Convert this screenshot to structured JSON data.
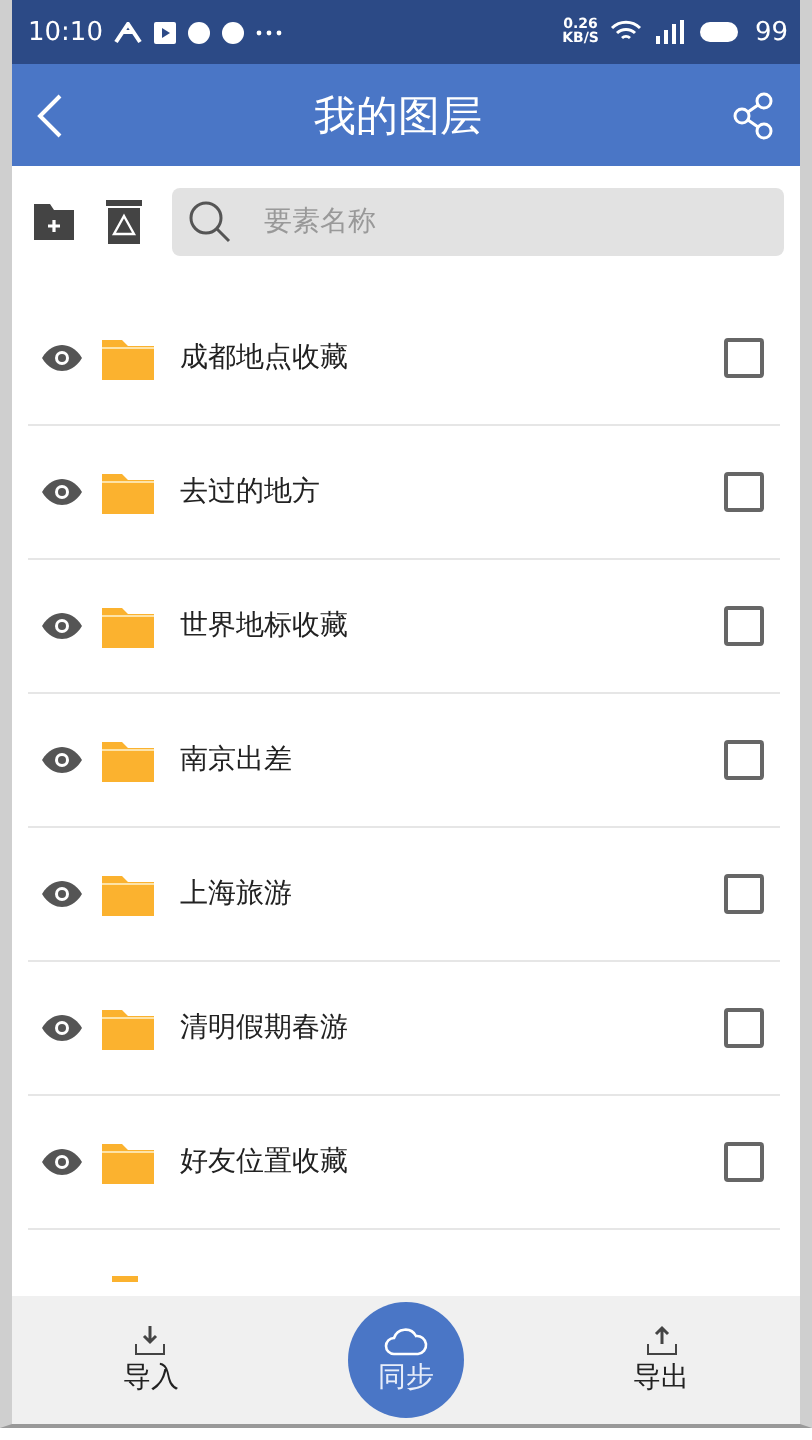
{
  "status_bar": {
    "time": "10:10",
    "speed": "0.26\nKB/S",
    "battery": "99"
  },
  "header": {
    "title": "我的图层"
  },
  "search": {
    "placeholder": "要素名称"
  },
  "layers": [
    {
      "name": "成都地点收藏",
      "visible": true,
      "checked": false
    },
    {
      "name": "去过的地方",
      "visible": true,
      "checked": false
    },
    {
      "name": "世界地标收藏",
      "visible": true,
      "checked": false
    },
    {
      "name": "南京出差",
      "visible": true,
      "checked": false
    },
    {
      "name": "上海旅游",
      "visible": true,
      "checked": false
    },
    {
      "name": "清明假期春游",
      "visible": true,
      "checked": false
    },
    {
      "name": "好友位置收藏",
      "visible": true,
      "checked": false
    }
  ],
  "bottom_bar": [
    {
      "label": "导入",
      "kind": "import"
    },
    {
      "label": "同步",
      "kind": "sync"
    },
    {
      "label": "导出",
      "kind": "export"
    }
  ]
}
